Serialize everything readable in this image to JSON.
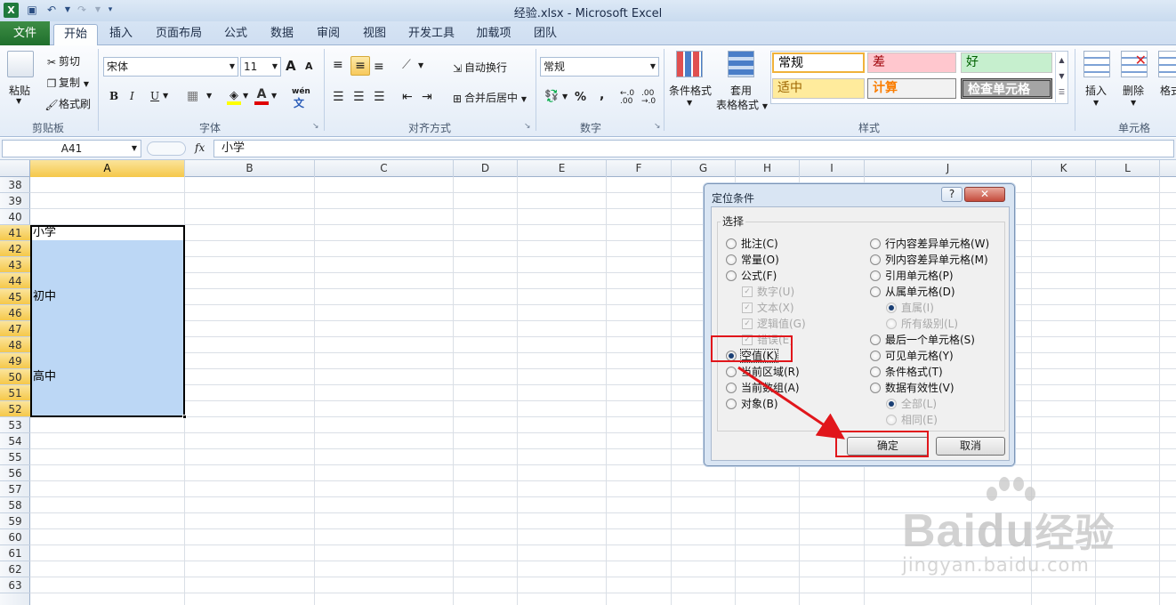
{
  "window": {
    "title": "经验.xlsx - Microsoft Excel",
    "app_icon": "X"
  },
  "tabs": [
    "文件",
    "开始",
    "插入",
    "页面布局",
    "公式",
    "数据",
    "审阅",
    "视图",
    "开发工具",
    "加载项",
    "团队"
  ],
  "ribbon": {
    "clipboard": {
      "paste": "粘贴",
      "cut": "剪切",
      "copy": "复制",
      "format_painter": "格式刷",
      "label": "剪贴板"
    },
    "font": {
      "name": "宋体",
      "size": "11",
      "label": "字体",
      "bold": "B",
      "italic": "I",
      "underline": "U",
      "grow": "A",
      "shrink": "A",
      "font_color": "A",
      "wen": "wén"
    },
    "alignment": {
      "wrap": "自动换行",
      "merge": "合并后居中",
      "label": "对齐方式"
    },
    "number": {
      "format": "常规",
      "percent": "%",
      "comma": ",",
      "label": "数字"
    },
    "styles": {
      "conditional": "条件格式",
      "table_line1": "套用",
      "table_line2": "表格格式",
      "label": "样式",
      "cells": [
        {
          "text": "常规",
          "bg": "#ffffff",
          "fg": "#000000"
        },
        {
          "text": "差",
          "bg": "#ffc7ce",
          "fg": "#9c0006"
        },
        {
          "text": "好",
          "bg": "#c6efce",
          "fg": "#006100"
        },
        {
          "text": "适中",
          "bg": "#ffeb9c",
          "fg": "#9c6500"
        },
        {
          "text": "计算",
          "bg": "#f2f2f2",
          "fg": "#fa7d00"
        },
        {
          "text": "检查单元格",
          "bg": "#a5a5a5",
          "fg": "#ffffff"
        }
      ]
    },
    "cells_group": {
      "insert": "插入",
      "delete": "删除",
      "format": "格式",
      "label": "单元格"
    }
  },
  "formula_bar": {
    "name_box": "A41",
    "fx": "fx",
    "value": "小学"
  },
  "columns": [
    "A",
    "B",
    "C",
    "D",
    "E",
    "F",
    "G",
    "H",
    "I",
    "J",
    "K",
    "L"
  ],
  "rows": [
    "38",
    "39",
    "40",
    "41",
    "42",
    "43",
    "44",
    "45",
    "46",
    "47",
    "48",
    "49",
    "50",
    "51",
    "52",
    "53",
    "54",
    "55",
    "56",
    "57",
    "58",
    "59",
    "60",
    "61",
    "62",
    "63"
  ],
  "cells": {
    "a41": "小学",
    "a45": "初中",
    "a50": "高中"
  },
  "dialog": {
    "title": "定位条件",
    "help": "?",
    "close": "✕",
    "group_label": "选择",
    "left_options": [
      {
        "label": "批注(C)",
        "type": "radio",
        "checked": false,
        "disabled": false
      },
      {
        "label": "常量(O)",
        "type": "radio",
        "checked": false,
        "disabled": false
      },
      {
        "label": "公式(F)",
        "type": "radio",
        "checked": false,
        "disabled": false
      },
      {
        "label": "数字(U)",
        "type": "check",
        "checked": true,
        "disabled": true
      },
      {
        "label": "文本(X)",
        "type": "check",
        "checked": true,
        "disabled": true
      },
      {
        "label": "逻辑值(G)",
        "type": "check",
        "checked": true,
        "disabled": true
      },
      {
        "label": "错误(E)",
        "type": "check",
        "checked": true,
        "disabled": true
      },
      {
        "label": "空值(K)",
        "type": "radio",
        "checked": true,
        "disabled": false
      },
      {
        "label": "当前区域(R)",
        "type": "radio",
        "checked": false,
        "disabled": false
      },
      {
        "label": "当前数组(A)",
        "type": "radio",
        "checked": false,
        "disabled": false
      },
      {
        "label": "对象(B)",
        "type": "radio",
        "checked": false,
        "disabled": false
      }
    ],
    "right_options": [
      {
        "label": "行内容差异单元格(W)",
        "checked": false,
        "disabled": false
      },
      {
        "label": "列内容差异单元格(M)",
        "checked": false,
        "disabled": false
      },
      {
        "label": "引用单元格(P)",
        "checked": false,
        "disabled": false
      },
      {
        "label": "从属单元格(D)",
        "checked": false,
        "disabled": false
      },
      {
        "label": "直属(I)",
        "checked": true,
        "disabled": true
      },
      {
        "label": "所有级别(L)",
        "checked": false,
        "disabled": true
      },
      {
        "label": "最后一个单元格(S)",
        "checked": false,
        "disabled": false
      },
      {
        "label": "可见单元格(Y)",
        "checked": false,
        "disabled": false
      },
      {
        "label": "条件格式(T)",
        "checked": false,
        "disabled": false
      },
      {
        "label": "数据有效性(V)",
        "checked": false,
        "disabled": false
      },
      {
        "label": "全部(L)",
        "checked": true,
        "disabled": true
      },
      {
        "label": "相同(E)",
        "checked": false,
        "disabled": true
      }
    ],
    "ok": "确定",
    "cancel": "取消"
  },
  "watermark": {
    "brand": "Bai",
    "brand2": "du",
    "cn": "经验",
    "url": "jingyan.baidu.com"
  },
  "colors": {
    "highlight": "#e1161b",
    "selection": "#bcd7f5",
    "header_selected": "#f5c84a"
  }
}
